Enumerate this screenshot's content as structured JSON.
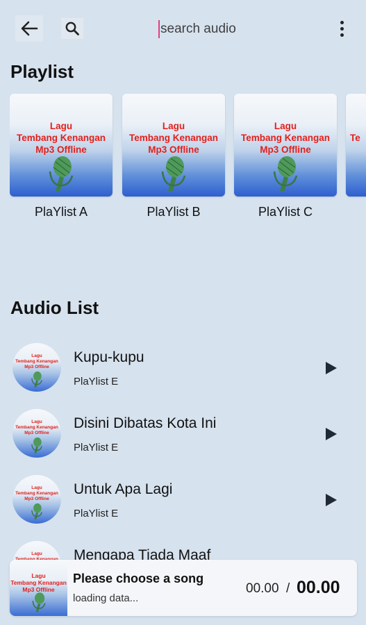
{
  "search": {
    "placeholder": "search audio"
  },
  "icons": {
    "back": "arrow-left",
    "search": "magnifier",
    "more": "vertical-dots",
    "play": "play-triangle"
  },
  "colors": {
    "background": "#d6e2ee",
    "cover_text": "#e3201b",
    "cover_blue": "#2e5fcf"
  },
  "cover_art": {
    "line1": "Lagu",
    "line2": "Tembang Kenangan",
    "line3": "Mp3 Offline",
    "line2_partial": "Te"
  },
  "playlist": {
    "title": "Playlist",
    "items": [
      {
        "label": "PlaYlist A"
      },
      {
        "label": "PlaYlist B"
      },
      {
        "label": "PlaYlist C"
      }
    ]
  },
  "audio": {
    "title": "Audio List",
    "items": [
      {
        "title": "Kupu-kupu",
        "playlist": "PlaYlist E"
      },
      {
        "title": "Disini Dibatas Kota Ini",
        "playlist": "PlaYlist E"
      },
      {
        "title": "Untuk Apa Lagi",
        "playlist": "PlaYlist E"
      },
      {
        "title": "Mengapa Tiada Maaf",
        "playlist": ""
      }
    ]
  },
  "player": {
    "title": "Please choose a song",
    "status": "loading data...",
    "current_time": "00.00",
    "separator": "/",
    "total_time": "00.00"
  }
}
